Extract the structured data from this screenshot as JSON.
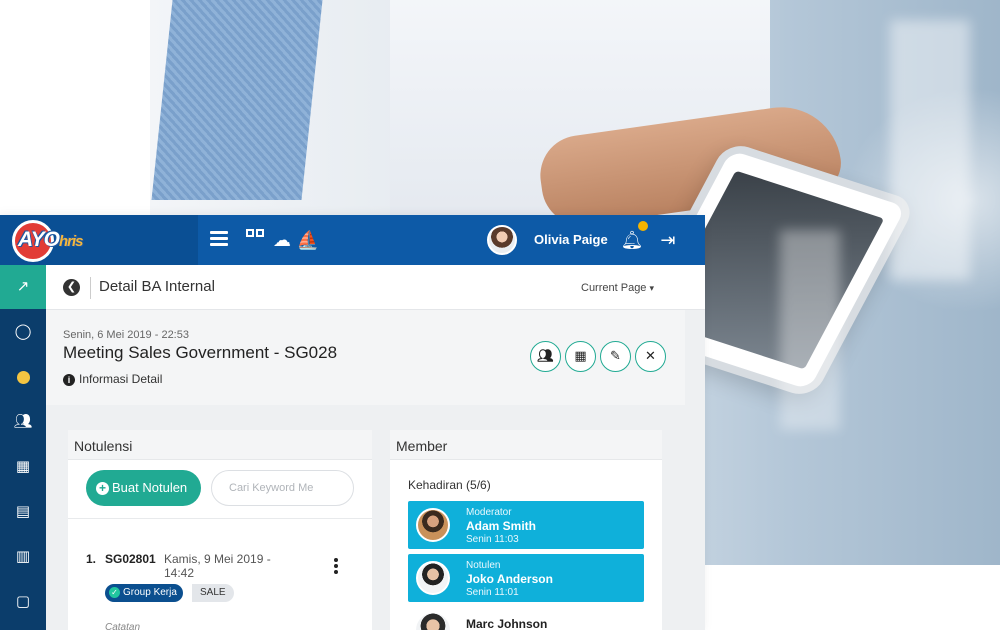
{
  "app": {
    "logo_text": "AYO",
    "logo_sub": "hris",
    "user_name": "Olivia Paige"
  },
  "page": {
    "title": "Detail BA Internal",
    "current_page_label": "Current Page"
  },
  "meeting": {
    "date": "Senin, 6 Mei 2019 - 22:53",
    "title": "Meeting Sales Government - SG028",
    "info_label": "Informasi Detail"
  },
  "notulensi": {
    "heading": "Notulensi",
    "add_button": "Buat Notulen",
    "search_placeholder": "Cari Keyword Me",
    "items": [
      {
        "num": "1.",
        "id": "SG02801",
        "date": "Kamis, 9 Mei 2019 - 14:42",
        "tag_group": "Group Kerja",
        "tag_sale": "SALE",
        "note_label": "Catatan"
      }
    ]
  },
  "member": {
    "heading": "Member",
    "attendance": "Kehadiran (5/6)",
    "cards": [
      {
        "role": "Moderator",
        "name": "Adam Smith",
        "time": "Senin 11:03"
      },
      {
        "role": "Notulen",
        "name": "Joko Anderson",
        "time": "Senin 11:01"
      }
    ],
    "others": [
      {
        "name": "Marc Johnson"
      }
    ]
  },
  "icons": {
    "sidebar": [
      "chart-icon",
      "user-icon",
      "circle-icon",
      "team-icon",
      "calculator-icon",
      "presentation-icon",
      "bar-chart-icon",
      "chat-icon"
    ],
    "actions": [
      "members-icon",
      "qr-code-icon",
      "edit-icon",
      "close-icon"
    ]
  },
  "colors": {
    "topbar": "#0d5aa7",
    "sidebar": "#0b3d6b",
    "accent": "#21aa93",
    "member_card": "#0fb0da",
    "notification_dot": "#f4b400"
  }
}
